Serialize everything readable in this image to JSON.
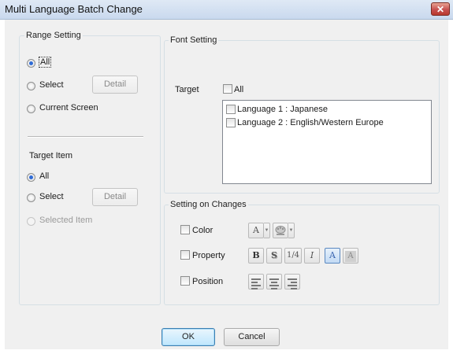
{
  "window": {
    "title": "Multi Language Batch Change",
    "close_symbol": "✕"
  },
  "range_setting": {
    "label": "Range Setting",
    "options": [
      {
        "label": "All",
        "selected": true
      },
      {
        "label": "Select",
        "selected": false
      },
      {
        "label": "Current Screen",
        "selected": false
      }
    ],
    "detail_label": "Detail"
  },
  "target_item": {
    "label": "Target Item",
    "options": [
      {
        "label": "All",
        "selected": true
      },
      {
        "label": "Select",
        "selected": false
      },
      {
        "label": "Selected Item",
        "selected": false,
        "disabled": true
      }
    ],
    "detail_label": "Detail"
  },
  "font_setting": {
    "label": "Font Setting",
    "target_label": "Target",
    "all_label": "All",
    "languages": [
      "Language 1 : Japanese",
      "Language 2 : English/Western Europe"
    ]
  },
  "changes": {
    "label": "Setting on Changes",
    "color_label": "Color",
    "property_label": "Property",
    "position_label": "Position",
    "font_color_glyph": "A",
    "bold_glyph": "B",
    "shadow_glyph": "S",
    "fraction_glyph": "1/4",
    "italic_glyph": "I",
    "solid_glyph": "A",
    "transparent_glyph": "A"
  },
  "buttons": {
    "ok": "OK",
    "cancel": "Cancel"
  },
  "colors": {
    "accent": "#2f6bd6",
    "title_bar": "#cddcf0",
    "close": "#c75050",
    "face": "#f0f0f0"
  }
}
